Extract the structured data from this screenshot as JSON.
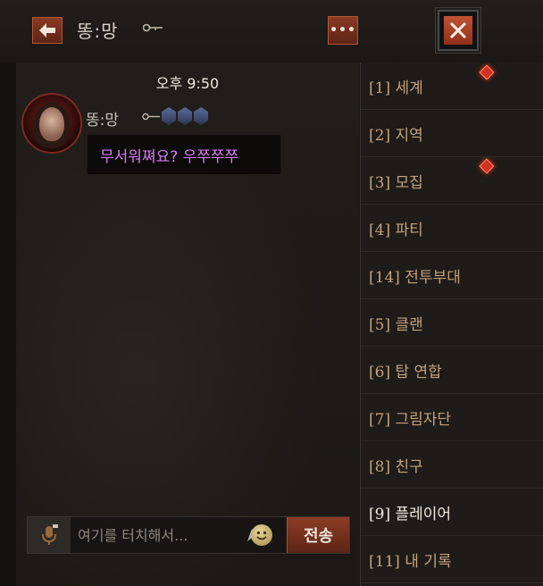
{
  "header": {
    "name": "똥:망",
    "close_symbol": "✕",
    "more_symbol": "•••"
  },
  "chat": {
    "timestamp": "오후 9:50",
    "messages": [
      {
        "sender": "똥:망",
        "text": "무서워쪄요? 우쭈쭈쭈",
        "rank_count": 3
      }
    ]
  },
  "input": {
    "placeholder": "여기를 터치해서...",
    "send_label": "전송"
  },
  "channels": [
    {
      "label": "[1] 세계",
      "notification": true,
      "active": false
    },
    {
      "label": "[2] 지역",
      "notification": false,
      "active": false
    },
    {
      "label": "[3] 모집",
      "notification": true,
      "active": false
    },
    {
      "label": "[4] 파티",
      "notification": false,
      "active": false
    },
    {
      "label": "[14] 전투부대",
      "notification": false,
      "active": false
    },
    {
      "label": "[5] 클랜",
      "notification": false,
      "active": false
    },
    {
      "label": "[6] 탑 연합",
      "notification": false,
      "active": false
    },
    {
      "label": "[7] 그림자단",
      "notification": false,
      "active": false
    },
    {
      "label": "[8] 친구",
      "notification": false,
      "active": false
    },
    {
      "label": "[9] 플레이어",
      "notification": false,
      "active": true
    },
    {
      "label": "[11] 내 기록",
      "notification": false,
      "active": false
    }
  ],
  "colors": {
    "accent": "#8d3d26",
    "message_text": "#d67bf0",
    "notification": "#d4301f"
  },
  "icons": {
    "back": "arrow-left-icon",
    "more": "more-icon",
    "close": "close-icon",
    "mic": "microphone-icon",
    "emoji": "emoji-icon",
    "scroll": "arrow-up-icon",
    "badge": "key-badge-icon",
    "rank": "rank-shield-icon"
  }
}
